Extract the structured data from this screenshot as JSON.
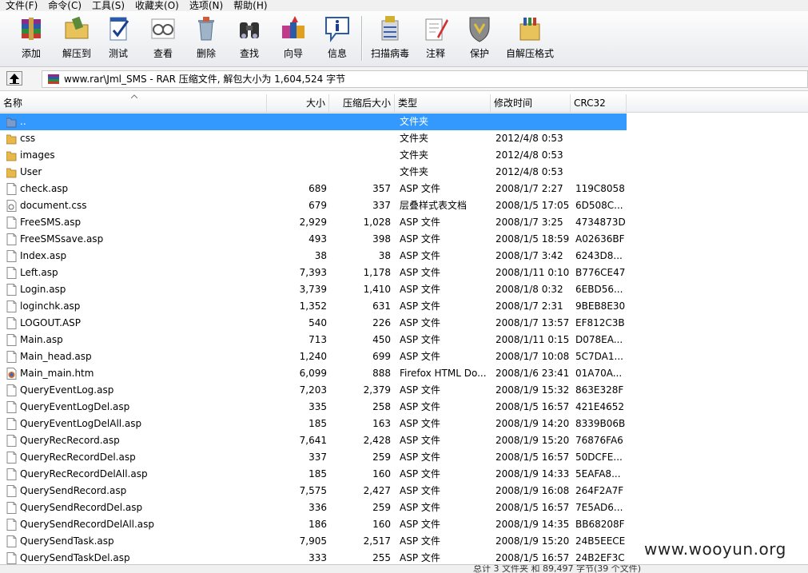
{
  "menu": [
    "文件(F)",
    "命令(C)",
    "工具(S)",
    "收藏夹(O)",
    "选项(N)",
    "帮助(H)"
  ],
  "toolbar": {
    "buttons": [
      {
        "label": "添加",
        "icon": "add-archive-icon"
      },
      {
        "label": "解压到",
        "icon": "extract-folder-icon"
      },
      {
        "label": "测试",
        "icon": "test-check-icon"
      },
      {
        "label": "查看",
        "icon": "view-glasses-icon"
      },
      {
        "label": "删除",
        "icon": "delete-recycle-icon"
      },
      {
        "label": "查找",
        "icon": "find-binoculars-icon"
      },
      {
        "label": "向导",
        "icon": "wizard-icon"
      },
      {
        "label": "信息",
        "icon": "info-icon"
      },
      {
        "label": "扫描病毒",
        "icon": "virus-scan-icon"
      },
      {
        "label": "注释",
        "icon": "comment-pen-icon"
      },
      {
        "label": "保护",
        "icon": "protect-shield-icon"
      },
      {
        "label": "自解压格式",
        "icon": "sfx-box-icon"
      }
    ]
  },
  "path": {
    "text": "www.rar\\Jml_SMS - RAR 压缩文件, 解包大小为 1,604,524 字节"
  },
  "columns": {
    "name": "名称",
    "size": "大小",
    "packed": "压缩后大小",
    "type": "类型",
    "modified": "修改时间",
    "crc": "CRC32"
  },
  "files": [
    {
      "name": "..",
      "size": "",
      "packed": "",
      "type": "文件夹",
      "modified": "",
      "crc": "",
      "kind": "folder-up",
      "selected": true
    },
    {
      "name": "css",
      "size": "",
      "packed": "",
      "type": "文件夹",
      "modified": "2012/4/8 0:53",
      "crc": "",
      "kind": "folder"
    },
    {
      "name": "images",
      "size": "",
      "packed": "",
      "type": "文件夹",
      "modified": "2012/4/8 0:53",
      "crc": "",
      "kind": "folder"
    },
    {
      "name": "User",
      "size": "",
      "packed": "",
      "type": "文件夹",
      "modified": "2012/4/8 0:53",
      "crc": "",
      "kind": "folder"
    },
    {
      "name": "check.asp",
      "size": "689",
      "packed": "357",
      "type": "ASP 文件",
      "modified": "2008/1/7 2:27",
      "crc": "119C8058",
      "kind": "file"
    },
    {
      "name": "document.css",
      "size": "679",
      "packed": "337",
      "type": "层叠样式表文档",
      "modified": "2008/1/5 17:05",
      "crc": "6D508C...",
      "kind": "css"
    },
    {
      "name": "FreeSMS.asp",
      "size": "2,929",
      "packed": "1,028",
      "type": "ASP 文件",
      "modified": "2008/1/7 3:25",
      "crc": "4734873D",
      "kind": "file"
    },
    {
      "name": "FreeSMSsave.asp",
      "size": "493",
      "packed": "398",
      "type": "ASP 文件",
      "modified": "2008/1/5 18:59",
      "crc": "A02636BF",
      "kind": "file"
    },
    {
      "name": "Index.asp",
      "size": "38",
      "packed": "38",
      "type": "ASP 文件",
      "modified": "2008/1/7 3:42",
      "crc": "6243D8...",
      "kind": "file"
    },
    {
      "name": "Left.asp",
      "size": "7,393",
      "packed": "1,178",
      "type": "ASP 文件",
      "modified": "2008/1/11 0:10",
      "crc": "B776CE47",
      "kind": "file"
    },
    {
      "name": "Login.asp",
      "size": "3,739",
      "packed": "1,410",
      "type": "ASP 文件",
      "modified": "2008/1/8 0:32",
      "crc": "6EBD56...",
      "kind": "file"
    },
    {
      "name": "loginchk.asp",
      "size": "1,352",
      "packed": "631",
      "type": "ASP 文件",
      "modified": "2008/1/7 2:31",
      "crc": "9BEB8E30",
      "kind": "file"
    },
    {
      "name": "LOGOUT.ASP",
      "size": "540",
      "packed": "226",
      "type": "ASP 文件",
      "modified": "2008/1/7 13:57",
      "crc": "EF812C3B",
      "kind": "file"
    },
    {
      "name": "Main.asp",
      "size": "713",
      "packed": "450",
      "type": "ASP 文件",
      "modified": "2008/1/11 0:15",
      "crc": "D078EA...",
      "kind": "file"
    },
    {
      "name": "Main_head.asp",
      "size": "1,240",
      "packed": "699",
      "type": "ASP 文件",
      "modified": "2008/1/7 10:08",
      "crc": "5C7DA1...",
      "kind": "file"
    },
    {
      "name": "Main_main.htm",
      "size": "6,099",
      "packed": "888",
      "type": "Firefox HTML Do...",
      "modified": "2008/1/6 23:41",
      "crc": "01A70A...",
      "kind": "htm"
    },
    {
      "name": "QueryEventLog.asp",
      "size": "7,203",
      "packed": "2,379",
      "type": "ASP 文件",
      "modified": "2008/1/9 15:32",
      "crc": "863E328F",
      "kind": "file"
    },
    {
      "name": "QueryEventLogDel.asp",
      "size": "335",
      "packed": "258",
      "type": "ASP 文件",
      "modified": "2008/1/5 16:57",
      "crc": "421E4652",
      "kind": "file"
    },
    {
      "name": "QueryEventLogDelAll.asp",
      "size": "185",
      "packed": "163",
      "type": "ASP 文件",
      "modified": "2008/1/9 14:20",
      "crc": "8339B06B",
      "kind": "file"
    },
    {
      "name": "QueryRecRecord.asp",
      "size": "7,641",
      "packed": "2,428",
      "type": "ASP 文件",
      "modified": "2008/1/9 15:20",
      "crc": "76876FA6",
      "kind": "file"
    },
    {
      "name": "QueryRecRecordDel.asp",
      "size": "337",
      "packed": "259",
      "type": "ASP 文件",
      "modified": "2008/1/5 16:57",
      "crc": "50DCFE...",
      "kind": "file"
    },
    {
      "name": "QueryRecRecordDelAll.asp",
      "size": "185",
      "packed": "160",
      "type": "ASP 文件",
      "modified": "2008/1/9 14:33",
      "crc": "5EAFA8...",
      "kind": "file"
    },
    {
      "name": "QuerySendRecord.asp",
      "size": "7,575",
      "packed": "2,427",
      "type": "ASP 文件",
      "modified": "2008/1/9 16:08",
      "crc": "264F2A7F",
      "kind": "file"
    },
    {
      "name": "QuerySendRecordDel.asp",
      "size": "336",
      "packed": "259",
      "type": "ASP 文件",
      "modified": "2008/1/5 16:57",
      "crc": "7E5AD6...",
      "kind": "file"
    },
    {
      "name": "QuerySendRecordDelAll.asp",
      "size": "186",
      "packed": "160",
      "type": "ASP 文件",
      "modified": "2008/1/9 14:35",
      "crc": "BB68208F",
      "kind": "file"
    },
    {
      "name": "QuerySendTask.asp",
      "size": "7,905",
      "packed": "2,517",
      "type": "ASP 文件",
      "modified": "2008/1/9 15:20",
      "crc": "24B5EECE",
      "kind": "file"
    },
    {
      "name": "QuerySendTaskDel.asp",
      "size": "333",
      "packed": "255",
      "type": "ASP 文件",
      "modified": "2008/1/5 16:57",
      "crc": "24B2EF3C",
      "kind": "file"
    }
  ],
  "status": {
    "text": "总计 3 文件夹 和 89,497 字节(39 个文件)"
  },
  "watermark": "www.wooyun.org",
  "colors": {
    "selection": "#3399ff",
    "folder": "#e8b84a"
  }
}
